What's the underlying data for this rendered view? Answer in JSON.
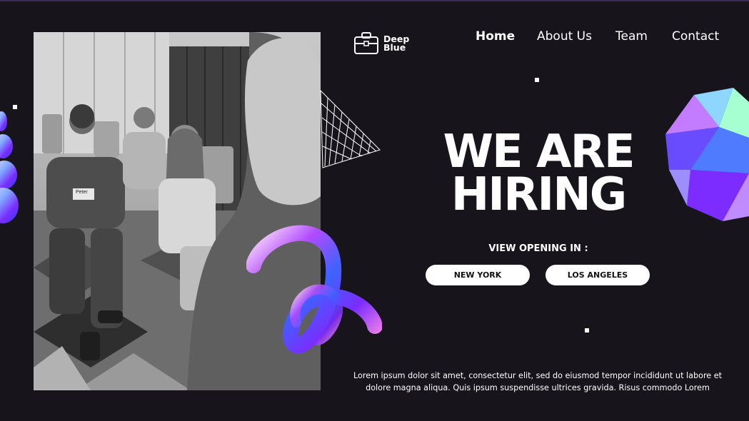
{
  "brand": {
    "name_line1": "Deep",
    "name_line2": "Blue",
    "icon": "briefcase-icon"
  },
  "nav": {
    "items": [
      {
        "label": "Home",
        "active": true
      },
      {
        "label": "About Us",
        "active": false
      },
      {
        "label": "Team",
        "active": false
      },
      {
        "label": "Contact",
        "active": false
      }
    ]
  },
  "hero": {
    "headline_line1": "WE ARE",
    "headline_line2": "HIRING",
    "view_label": "VIEW OPENING IN :",
    "locations": [
      "NEW YORK",
      "LOS ANGELES"
    ],
    "body": "Lorem ipsum dolor sit amet, consectetur elit, sed do eiusmod tempor incididunt ut labore et dolore magna aliqua. Quis ipsum suspendisse ultrices gravida. Risus commodo Lorem"
  },
  "photo": {
    "name_tag": "Peter"
  },
  "colors": {
    "background": "#17151b",
    "button": "#ffffff",
    "accent_purple": "#7b3bff",
    "accent_blue": "#2f6bff"
  }
}
